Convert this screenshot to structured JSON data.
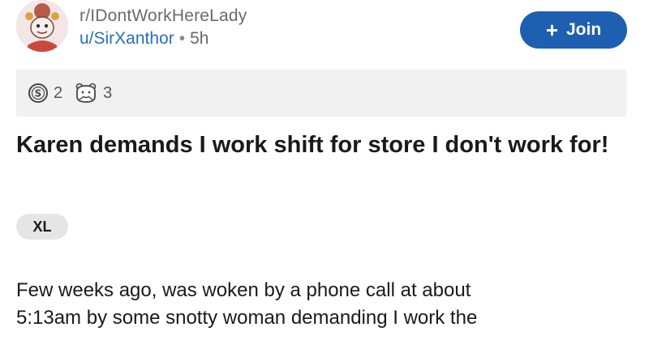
{
  "post": {
    "subreddit": "r/IDontWorkHereLady",
    "username": "u/SirXanthor",
    "separator": "•",
    "time": "5h",
    "join_label": "Join",
    "join_icon": "plus-icon",
    "awards": [
      {
        "icon": "silver-award-icon",
        "count": "2"
      },
      {
        "icon": "wholesome-award-icon",
        "count": "3"
      }
    ],
    "title": "Karen demands I work shift for store I don't work for!",
    "flair": "XL",
    "body_lines": [
      "Few weeks ago, was woken by a phone call at about",
      "5:13am by some snotty woman demanding I work the"
    ]
  },
  "colors": {
    "join_button": "#1f5fb2",
    "username": "#2a6fb8",
    "awards_bar": "#f1f1f1",
    "flair_bg": "#e5e5e5"
  }
}
